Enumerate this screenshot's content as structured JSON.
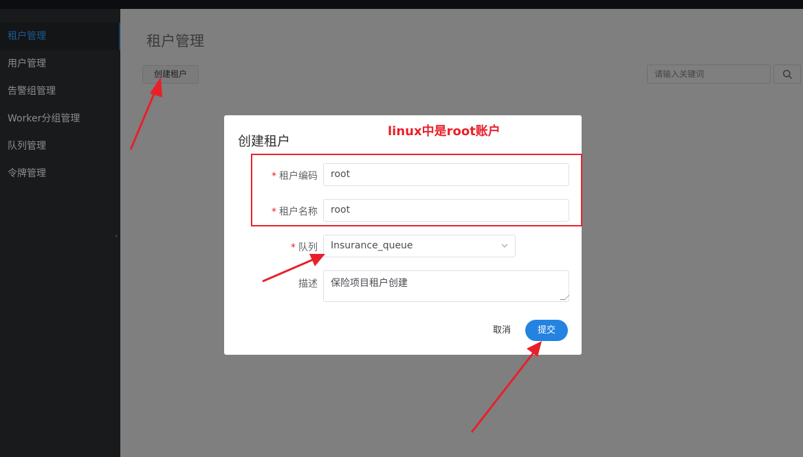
{
  "sidebar": {
    "items": [
      {
        "label": "租户管理"
      },
      {
        "label": "用户管理"
      },
      {
        "label": "告警组管理"
      },
      {
        "label": "Worker分组管理"
      },
      {
        "label": "队列管理"
      },
      {
        "label": "令牌管理"
      }
    ],
    "collapse_glyph": "‹"
  },
  "main": {
    "title": "租户管理",
    "create_button": "创建租户",
    "search_placeholder": "请输入关键词",
    "search_icon": "search-icon"
  },
  "modal": {
    "title": "创建租户",
    "annotation_note": "linux中是root账户",
    "fields": {
      "tenant_code": {
        "label": "租户编码",
        "value": "root",
        "required": "*"
      },
      "tenant_name": {
        "label": "租户名称",
        "value": "root",
        "required": "*"
      },
      "queue": {
        "label": "队列",
        "value": "Insurance_queue",
        "required": "*",
        "arrow_icon": "chevron-down-icon"
      },
      "description": {
        "label": "描述",
        "value": "保险项目租户创建"
      }
    },
    "cancel_label": "取消",
    "submit_label": "提交"
  },
  "colors": {
    "accent": "#2483e0",
    "annotation": "#e8202a",
    "sidebar_bg": "#191a1c",
    "overlay_bg": "#7f7f7f"
  }
}
